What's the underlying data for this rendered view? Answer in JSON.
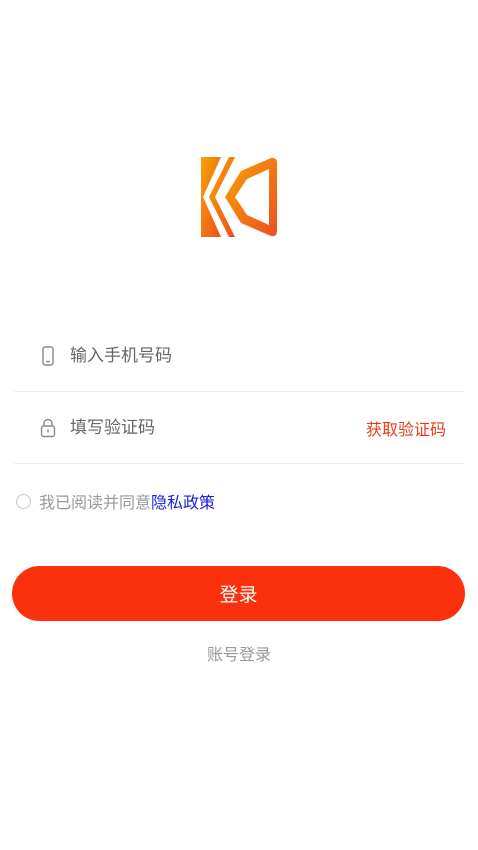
{
  "logo": {
    "icon": "app-logo-k",
    "colors": {
      "start": "#f5a000",
      "end": "#ef5a1e"
    }
  },
  "phone_field": {
    "icon": "phone-icon",
    "placeholder": "输入手机号码",
    "value": ""
  },
  "code_field": {
    "icon": "lock-icon",
    "placeholder": "填写验证码",
    "value": "",
    "get_code_label": "获取验证码"
  },
  "agreement": {
    "checked": false,
    "text": "我已阅读并同意",
    "link_text": "隐私政策"
  },
  "login_button": {
    "label": "登录"
  },
  "account_login": {
    "label": "账号登录"
  },
  "colors": {
    "primary": "#fa310c",
    "link": "#1a22d6",
    "accent_text": "#ee3a18"
  }
}
